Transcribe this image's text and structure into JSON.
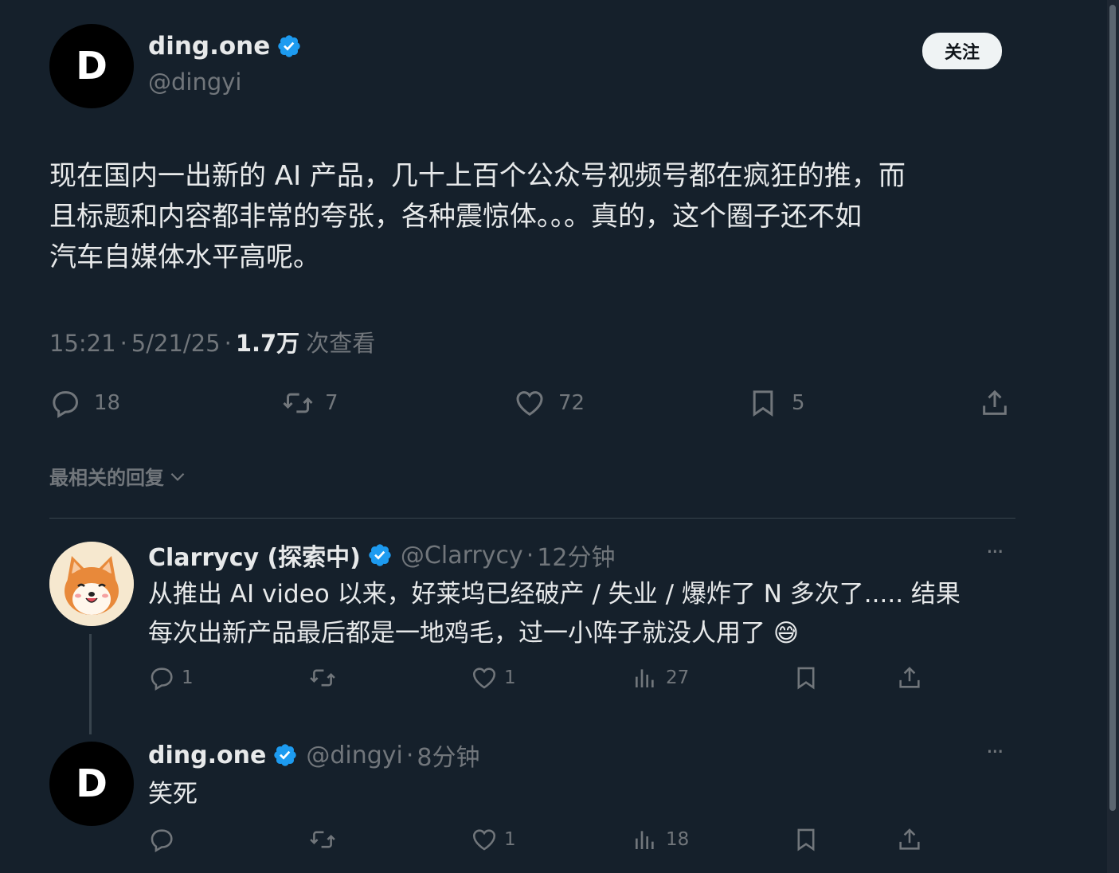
{
  "tweet": {
    "author": {
      "display_name": "ding.one",
      "handle": "@dingyi",
      "avatar_letter": "D"
    },
    "follow_label": "关注",
    "text_lines": [
      "现在国内一出新的 AI 产品，几十上百个公众号视频号都在疯狂的推，而",
      "且标题和内容都非常的夸张，各种震惊体。。。真的，这个圈子还不如",
      "汽车自媒体水平高呢。"
    ],
    "time": "15:21",
    "date": "5/21/25",
    "views_count": "1.7万",
    "views_label": "次查看",
    "actions": {
      "replies": "18",
      "reposts": "7",
      "likes": "72",
      "bookmarks": "5"
    }
  },
  "sort_label": "最相关的回复",
  "replies": [
    {
      "display_name": "Clarrycy (探索中)",
      "handle": "@Clarrycy",
      "time_ago": "12分钟",
      "text_lines": [
        "从推出 AI video 以来，好莱坞已经破产 / 失业 / 爆炸了 N 多次了..... 结果",
        "每次出新产品最后都是一地鸡毛，过一小阵子就没人用了 😅"
      ],
      "actions": {
        "replies": "1",
        "reposts": "",
        "likes": "1",
        "views": "27"
      }
    },
    {
      "display_name": "ding.one",
      "handle": "@dingyi",
      "avatar_letter": "D",
      "time_ago": "8分钟",
      "text_lines": [
        "笑死"
      ],
      "actions": {
        "replies": "",
        "reposts": "",
        "likes": "1",
        "views": "18"
      }
    }
  ],
  "separator": "·",
  "more_glyph": "···",
  "colors": {
    "background": "#15202b",
    "text": "#e7e9ea",
    "muted": "#71767b",
    "verified": "#1d9bf0"
  }
}
